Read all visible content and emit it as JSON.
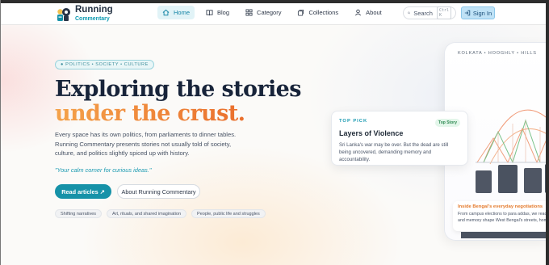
{
  "brand": {
    "title": "Running",
    "subtitle": "Commentary",
    "colors": {
      "teal": "#1692a8",
      "orange": "#f08a32",
      "navy": "#18243a"
    }
  },
  "nav": {
    "items": [
      {
        "label": "Home",
        "icon": "home-icon",
        "active": true
      },
      {
        "label": "Blog",
        "icon": "book-icon",
        "active": false
      },
      {
        "label": "Category",
        "icon": "grid-icon",
        "active": false
      },
      {
        "label": "Collections",
        "icon": "collection-icon",
        "active": false
      },
      {
        "label": "About",
        "icon": "user-icon",
        "active": false
      }
    ]
  },
  "search": {
    "label": "Search",
    "shortcut": "Ctrl K",
    "icon": "search-icon"
  },
  "signin": {
    "label": "Sign In",
    "icon": "login-icon"
  },
  "hero": {
    "tag": "● POLITICS • SOCIETY • CULTURE",
    "headline_line1": "Exploring the stories",
    "headline_line2": "under the crust.",
    "lede": "Every space has its own politics, from parliaments to dinner tables. Running Commentary presents stories not usually told of society, culture, and politics slightly spiced up with history.",
    "quote": "\"Your calm corner for curious ideas.\"",
    "primary_button": "Read articles ↗",
    "secondary_button": "About Running Commentary",
    "chips": [
      "Shifting narratives",
      "Art, rituals, and shared imagination",
      "People, public life and struggles"
    ]
  },
  "feature_card": {
    "kicker": "TOP PICK",
    "badge": "Top Story",
    "title": "Layers of Violence",
    "text": "Sri Lanka's war may be over. But the dead are still being uncovered, demanding memory and accountability."
  },
  "side_panel": {
    "label": "KOLKATA • HOOGHLY • HILLS",
    "foot_title": "Inside Bengal's everyday negotiations",
    "foot_line1": "From campus elections to para addas, we read h",
    "foot_line2": "and memory shape West Bengal's streets, homes"
  }
}
